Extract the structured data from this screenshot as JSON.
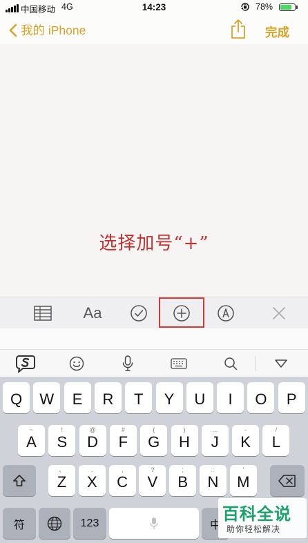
{
  "status_bar": {
    "carrier": "中国移动",
    "network": "4G",
    "time": "14:23",
    "battery_percent": "78%",
    "battery_level": 0.78
  },
  "nav": {
    "back_label": "我的 iPhone",
    "done_label": "完成"
  },
  "annotation": "选择加号“+”",
  "toolbar": {
    "format_label": "Aa"
  },
  "keyboard": {
    "row1": [
      {
        "k": "Q",
        "h": ""
      },
      {
        "k": "W",
        "h": ""
      },
      {
        "k": "E",
        "h": ""
      },
      {
        "k": "R",
        "h": ""
      },
      {
        "k": "T",
        "h": ""
      },
      {
        "k": "Y",
        "h": ""
      },
      {
        "k": "U",
        "h": ""
      },
      {
        "k": "I",
        "h": ""
      },
      {
        "k": "O",
        "h": ""
      },
      {
        "k": "P",
        "h": ""
      }
    ],
    "row2": [
      {
        "k": "A",
        "h": "~"
      },
      {
        "k": "S",
        "h": "!"
      },
      {
        "k": "D",
        "h": "@"
      },
      {
        "k": "F",
        "h": "#"
      },
      {
        "k": "G",
        "h": "("
      },
      {
        "k": "H",
        "h": ")"
      },
      {
        "k": "J",
        "h": "…"
      },
      {
        "k": "K",
        "h": "-"
      },
      {
        "k": "L",
        "h": "/"
      }
    ],
    "row3": [
      {
        "k": "Z",
        "h": "、"
      },
      {
        "k": "X",
        "h": "."
      },
      {
        "k": "C",
        "h": ","
      },
      {
        "k": "V",
        "h": "?"
      },
      {
        "k": "B",
        "h": ";"
      },
      {
        "k": "N",
        "h": ":"
      },
      {
        "k": "M",
        "h": "'"
      }
    ],
    "symbol_key": "符",
    "number_key": "123",
    "partial_key": "中"
  },
  "watermark": {
    "title": "百科全说",
    "subtitle": "助你轻松解决"
  },
  "colors": {
    "accent": "#d7a329",
    "annotation": "#c23230",
    "highlight": "#d53a37",
    "battery": "#4cd964",
    "watermark": "#1ba26a"
  }
}
